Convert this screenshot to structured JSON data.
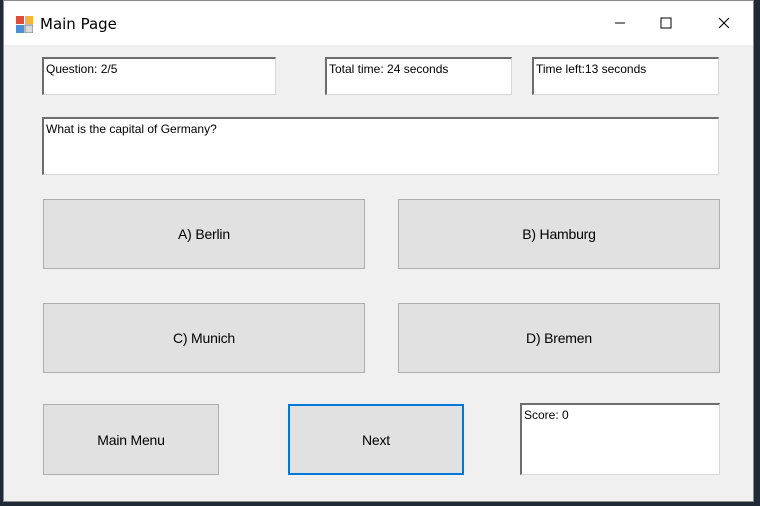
{
  "window": {
    "title": "Main Page",
    "icon": "app-form-icon",
    "controls": [
      "minimize-icon",
      "maximize-icon",
      "close-icon"
    ]
  },
  "status": {
    "question": "Question: 2/5",
    "total_time": "Total time: 24 seconds",
    "time_left": "Time left:13 seconds"
  },
  "question_text": "What is the capital of Germany?",
  "answers": {
    "a": "A) Berlin",
    "b": "B) Hamburg",
    "c": "C) Munich",
    "d": "D) Bremen"
  },
  "footer": {
    "main_menu_label": "Main Menu",
    "next_label": "Next",
    "score": "Score: 0"
  },
  "colors": {
    "focus_border": "#0078d7",
    "button_face": "#e1e1e1",
    "window_bg": "#f0f0f0"
  }
}
